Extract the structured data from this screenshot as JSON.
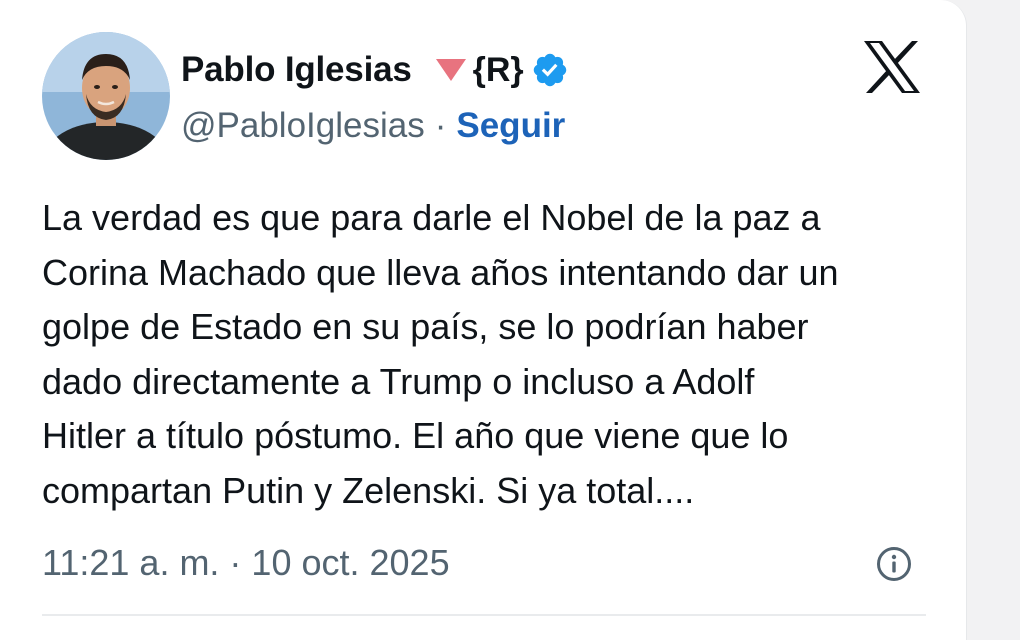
{
  "author": {
    "display_name": "Pablo Iglesias",
    "affiliation_badge": "{R}",
    "handle": "@PabloIglesias",
    "separator": "·",
    "follow_label": "Seguir",
    "avatar_icon": "profile-photo",
    "triangle_icon": "red-down-triangle-emoji",
    "triangle_color": "#e8737f",
    "verified_icon": "verified-badge",
    "verified_color": "#1d9bf0"
  },
  "platform": {
    "logo_icon": "x-logo"
  },
  "tweet": {
    "text": "La verdad es que para darle el Nobel de la paz a\nCorina Machado que lleva años intentando dar un\ngolpe de Estado en su país, se lo podrían haber\ndado directamente a Trump o incluso a Adolf\nHitler a título póstumo. El año que viene que lo\ncompartan Putin y Zelenski. Si ya total....",
    "timestamp": "11:21 a. m. · 10 oct. 2025",
    "info_icon": "info-icon"
  },
  "colors": {
    "text": "#0f1419",
    "secondary": "#536471",
    "link": "#1d63b8"
  }
}
